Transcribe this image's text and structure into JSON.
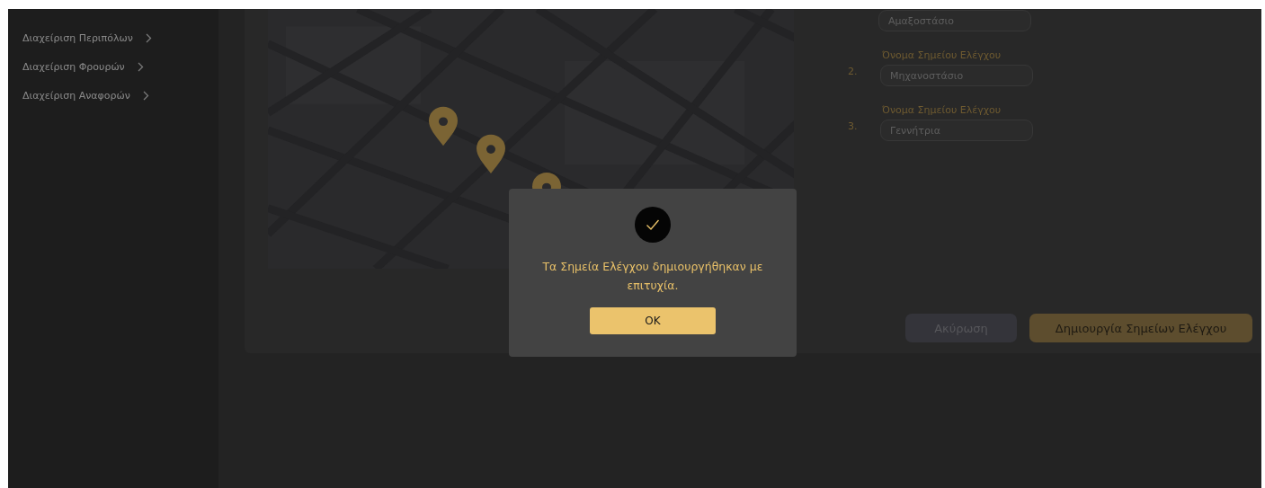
{
  "sidebar": {
    "items": [
      {
        "label": "Διαχείριση Περιπόλων"
      },
      {
        "label": "Διαχείριση Φρουρών"
      },
      {
        "label": "Διαχείριση Αναφορών"
      }
    ]
  },
  "checkpoints": [
    {
      "value": "Αμαξοστάσιο"
    },
    {
      "number": "2.",
      "label": "Όνομα Σημείου Ελέγχου",
      "value": "Μηχανοστάσιο"
    },
    {
      "number": "3.",
      "label": "Όνομα Σημείου Ελέγχου",
      "value": "Γεννήτρια"
    }
  ],
  "buttons": [
    {
      "kind": "secondary",
      "label": "Ακύρωση"
    },
    {
      "kind": "primary",
      "label": "Δημιουργία Σημείων Ελέγχου"
    }
  ],
  "dialog": {
    "message": "Τα Σημεία Ελέγχου δημιουργήθηκαν με επιτυχία.",
    "ok": "OK"
  }
}
